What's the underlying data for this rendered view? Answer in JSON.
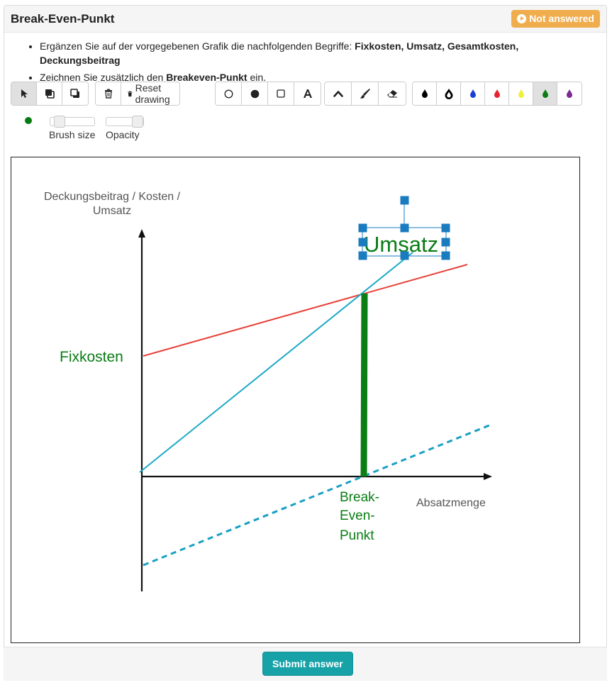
{
  "question": {
    "title": "Break-Even-Punkt",
    "status": "Not answered"
  },
  "instructions": [
    {
      "prefix": "Ergänzen Sie auf der vorgegebenen Grafik die nachfolgenden Begriffe: ",
      "bold": "Fixkosten, Umsatz, Gesamtkosten, Deckungsbeitrag",
      "suffix": ""
    },
    {
      "prefix": "Zeichnen Sie zusätzlich den ",
      "bold": "Breakeven-Punkt",
      "suffix": " ein."
    }
  ],
  "toolbar": {
    "reset_label": "Reset drawing",
    "ink_colors": [
      "#000000",
      "#000000",
      "#1b3fd6",
      "#e8232f",
      "#f2ef3a",
      "#0a7d14",
      "#7b2a93"
    ],
    "selected_color": "#067b10"
  },
  "brush": {
    "size_label": "Brush size",
    "opacity_label": "Opacity",
    "size": 0.1,
    "opacity": 1.0
  },
  "diagram": {
    "y_axis_label_line1": "Deckungsbeitrag / Kosten /",
    "y_axis_label_line2": "Umsatz",
    "x_axis_label": "Absatzmenge",
    "colors": {
      "fixed_cost_line": "#e8413a",
      "revenue_line": "#1ea9c8",
      "contribution_dashed": "#19a0c4",
      "annotation": "#0a7d14",
      "selection": "#1a7bbf"
    }
  },
  "annotations": {
    "fixkosten": "Fixkosten",
    "umsatz": "Umsatz",
    "break_even_line1": "Break-",
    "break_even_line2": "Even-",
    "break_even_line3": "Punkt"
  },
  "footer": {
    "submit_label": "Submit answer"
  }
}
